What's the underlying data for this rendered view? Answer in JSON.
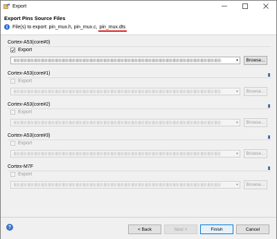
{
  "window": {
    "title": "Export"
  },
  "header": {
    "heading": "Export Pins Source Files",
    "info_prefix": "File(s) to export: pin_mux.h, pin_mux.c,",
    "info_highlight": "pin_mux.dts"
  },
  "groups": [
    {
      "label": "Cortex-A53(core#0)",
      "checkbox_label": "Export",
      "checked": true,
      "enabled": true,
      "browse_label": "Browse..."
    },
    {
      "label": "Cortex-A53(core#1)",
      "checkbox_label": "Export",
      "checked": false,
      "enabled": false,
      "browse_label": "Browse..."
    },
    {
      "label": "Cortex-A53(core#2)",
      "checkbox_label": "Export",
      "checked": false,
      "enabled": false,
      "browse_label": "Browse..."
    },
    {
      "label": "Cortex-A53(core#3)",
      "checkbox_label": "Export",
      "checked": false,
      "enabled": false,
      "browse_label": "Browse..."
    },
    {
      "label": "Cortex-M7F",
      "checkbox_label": "Export",
      "checked": false,
      "enabled": false,
      "browse_label": "Browse..."
    }
  ],
  "footer": {
    "help": "?",
    "back": "< Back",
    "next": "Next >",
    "finish": "Finish",
    "cancel": "Cancel"
  },
  "colors": {
    "accent": "#0078d7",
    "info_icon": "#2a6cd4",
    "highlight_underline": "#e02020"
  }
}
